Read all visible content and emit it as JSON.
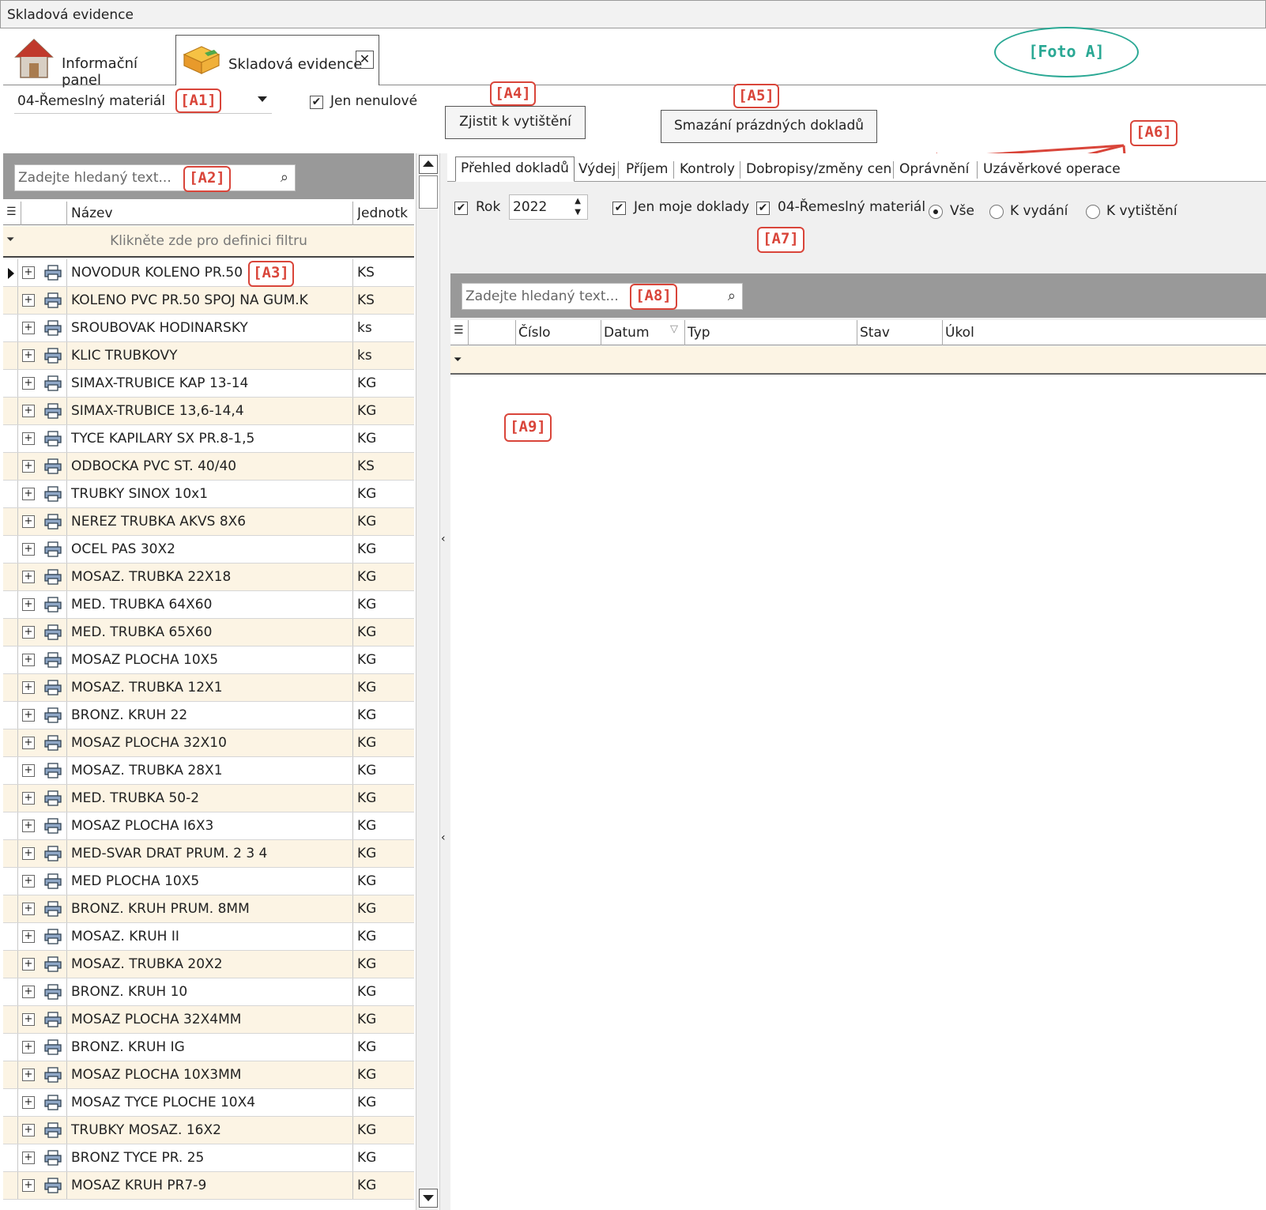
{
  "window_title": "Skladová evidence",
  "tabs": [
    {
      "label": "Informační panel",
      "icon": "home-icon"
    },
    {
      "label": "Skladová evidence",
      "icon": "boxes-icon",
      "close": "✕"
    }
  ],
  "foto_label": "[Foto A]",
  "callouts": {
    "a1": "[A1]",
    "a2": "[A2]",
    "a3": "[A3]",
    "a4": "[A4]",
    "a5": "[A5]",
    "a6": "[A6]",
    "a7": "[A7]",
    "a8": "[A8]",
    "a9": "[A9]"
  },
  "toolbar": {
    "category_value": "04-Řemeslný materiál",
    "jen_nenulove_label": "Jen nenulové",
    "jen_nenulove_checked": true,
    "zjistit_button": "Zjistit k vytištění",
    "smazani_button": "Smazání prázdných dokladů"
  },
  "left_grid": {
    "search_placeholder": "Zadejte hledaný text...",
    "columns": {
      "name": "Název",
      "unit": "Jednotk"
    },
    "filter_hint": "Klikněte zde pro definici filtru",
    "rows": [
      {
        "name": "NOVODUR KOLENO PR.50",
        "unit": "KS"
      },
      {
        "name": "KOLENO PVC PR.50 SPOJ NA GUM.K",
        "unit": "KS"
      },
      {
        "name": "SROUBOVAK HODINARSKY",
        "unit": "ks"
      },
      {
        "name": "KLIC TRUBKOVY",
        "unit": "ks"
      },
      {
        "name": "SIMAX-TRUBICE KAP 13-14",
        "unit": "KG"
      },
      {
        "name": "SIMAX-TRUBICE 13,6-14,4",
        "unit": "KG"
      },
      {
        "name": "TYCE KAPILARY SX PR.8-1,5",
        "unit": "KG"
      },
      {
        "name": "ODBOCKA PVC ST. 40/40",
        "unit": "KS"
      },
      {
        "name": "TRUBKY SINOX 10x1",
        "unit": "KG"
      },
      {
        "name": "NEREZ TRUBKA  AKVS 8X6",
        "unit": "KG"
      },
      {
        "name": "OCEL PAS 30X2",
        "unit": "KG"
      },
      {
        "name": "MOSAZ. TRUBKA 22X18",
        "unit": "KG"
      },
      {
        "name": "MED. TRUBKA 64X60",
        "unit": "KG"
      },
      {
        "name": "MED. TRUBKA 65X60",
        "unit": "KG"
      },
      {
        "name": "MOSAZ PLOCHA 10X5",
        "unit": "KG"
      },
      {
        "name": "MOSAZ. TRUBKA 12X1",
        "unit": "KG"
      },
      {
        "name": "BRONZ. KRUH 22",
        "unit": "KG"
      },
      {
        "name": "MOSAZ PLOCHA 32X10",
        "unit": "KG"
      },
      {
        "name": "MOSAZ. TRUBKA 28X1",
        "unit": "KG"
      },
      {
        "name": "MED. TRUBKA 50-2",
        "unit": "KG"
      },
      {
        "name": "MOSAZ PLOCHA I6X3",
        "unit": "KG"
      },
      {
        "name": "MED-SVAR DRAT PRUM. 2 3 4",
        "unit": "KG"
      },
      {
        "name": "MED PLOCHA 10X5",
        "unit": "KG"
      },
      {
        "name": "BRONZ. KRUH PRUM. 8MM",
        "unit": "KG"
      },
      {
        "name": "MOSAZ. KRUH II",
        "unit": "KG"
      },
      {
        "name": "MOSAZ. TRUBKA 20X2",
        "unit": "KG"
      },
      {
        "name": "BRONZ. KRUH 10",
        "unit": "KG"
      },
      {
        "name": "MOSAZ PLOCHA 32X4MM",
        "unit": "KG"
      },
      {
        "name": "BRONZ. KRUH IG",
        "unit": "KG"
      },
      {
        "name": "MOSAZ PLOCHA 10X3MM",
        "unit": "KG"
      },
      {
        "name": "MOSAZ TYCE PLOCHE 10X4",
        "unit": "KG"
      },
      {
        "name": "TRUBKY MOSAZ. 16X2",
        "unit": "KG"
      },
      {
        "name": "BRONZ TYCE  PR. 25",
        "unit": "KG"
      },
      {
        "name": "MOSAZ KRUH PR7-9",
        "unit": "KG"
      }
    ]
  },
  "right_tabs": [
    "Přehled dokladů",
    "Výdej",
    "Příjem",
    "Kontroly",
    "Dobropisy/změny cen",
    "Oprávnění",
    "Uzávěrkové operace"
  ],
  "filters": {
    "rok_label": "Rok",
    "rok_value": "2022",
    "jen_moje_label": "Jen moje doklady",
    "category_label": "04-Řemeslný materiál",
    "radio_vse": "Vše",
    "radio_k_vydani": "K vydání",
    "radio_k_vytisteni": "K vytištění"
  },
  "right_grid": {
    "search_placeholder": "Zadejte hledaný text...",
    "columns": [
      "Číslo",
      "Datum",
      "Typ",
      "Stav",
      "Úkol"
    ]
  },
  "colors": {
    "row_alt": "#fcf4e4",
    "callout": "#d9453a",
    "foto": "#2aa894",
    "panel_gray": "#999999"
  }
}
